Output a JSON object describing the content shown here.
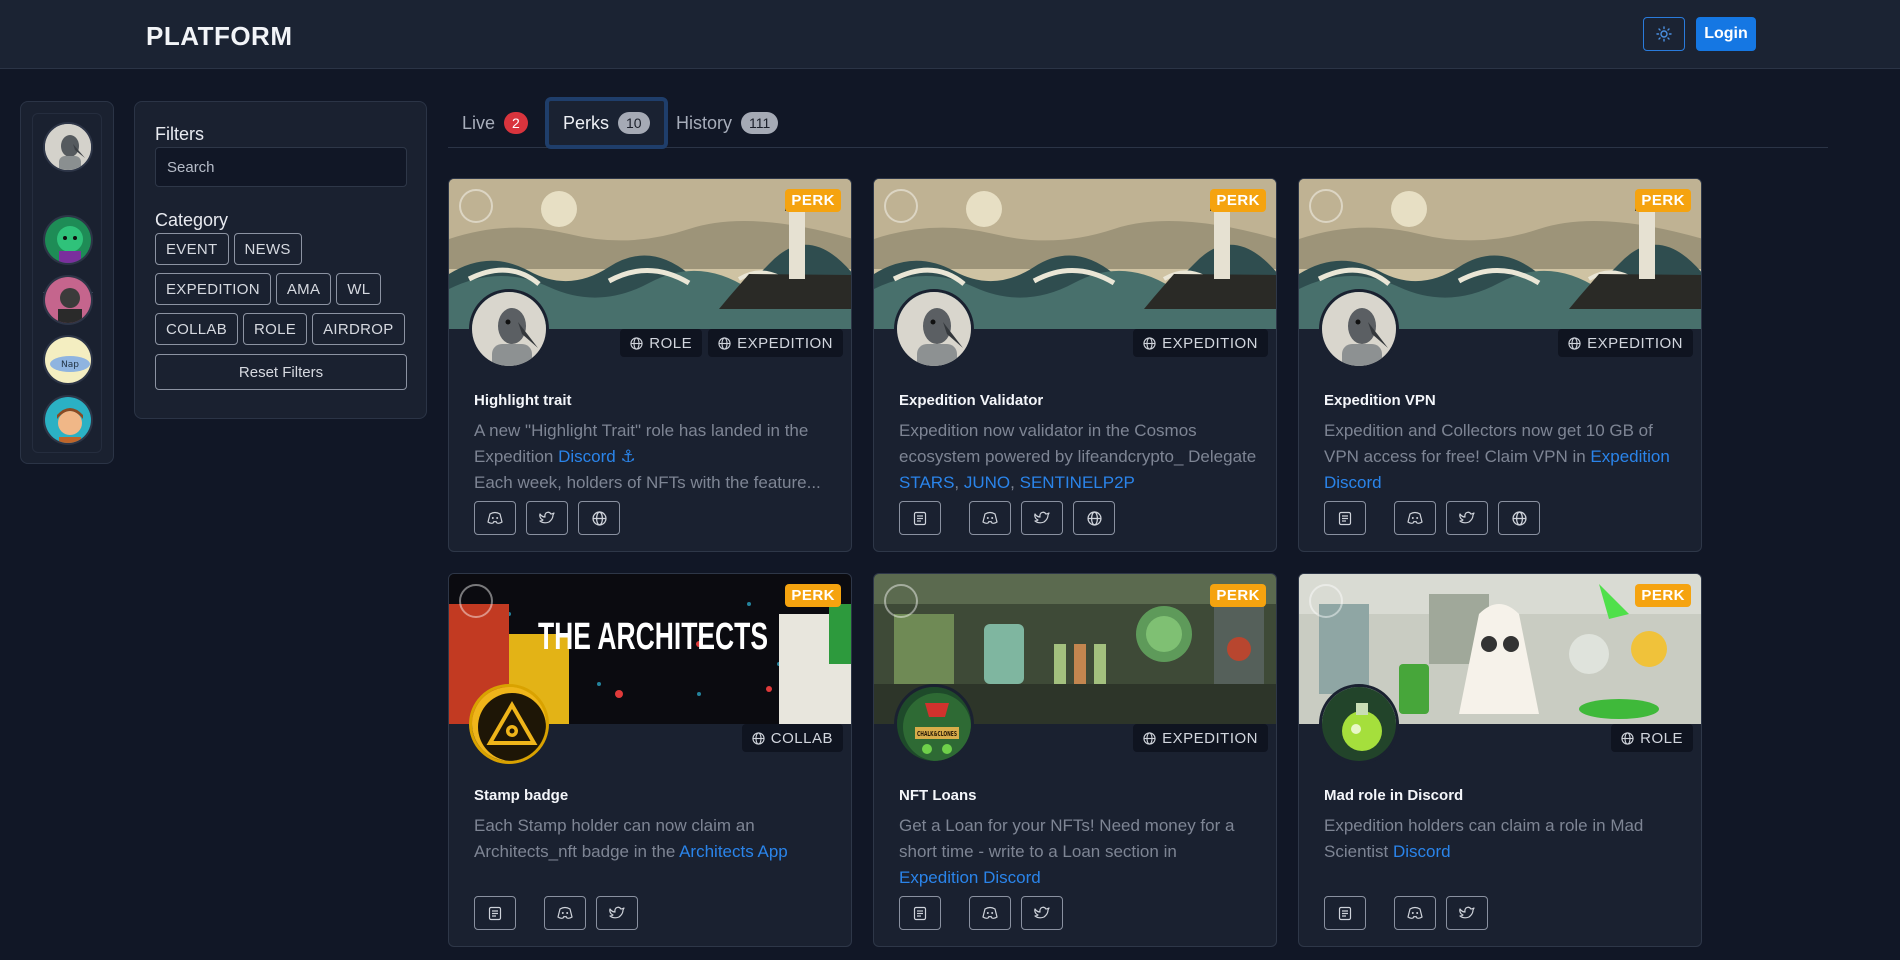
{
  "header": {
    "brand": "PLATFORM",
    "login_label": "Login"
  },
  "rail": {
    "avatars": [
      "bird-avatar",
      "alien-avatar",
      "character-avatar",
      "nap-time-avatar",
      "boy-avatar"
    ]
  },
  "filters": {
    "title": "Filters",
    "search_placeholder": "Search",
    "category_title": "Category",
    "categories": [
      "EVENT",
      "NEWS",
      "EXPEDITION",
      "AMA",
      "WL",
      "COLLAB",
      "ROLE",
      "AIRDROP"
    ],
    "reset_label": "Reset Filters"
  },
  "tabs": [
    {
      "label": "Live",
      "count": "2"
    },
    {
      "label": "Perks",
      "count": "10"
    },
    {
      "label": "History",
      "count": "111"
    }
  ],
  "cards": [
    {
      "badge": "PERK",
      "tags": [
        "ROLE",
        "EXPEDITION"
      ],
      "title": "Highlight trait",
      "desc_1": "A new \"Highlight Trait\" role has landed in the Expedition ",
      "link_1": "Discord ⚓",
      "desc_2": " Each week, holders of NFTs with the feature...",
      "icons": [
        "discord-icon",
        "twitter-icon",
        "globe-icon"
      ]
    },
    {
      "badge": "PERK",
      "tags": [
        "EXPEDITION"
      ],
      "title": "Expedition Validator",
      "desc_1": "Expedition now validator in the Cosmos ecosystem powered by lifeandcrypto_ Delegate ",
      "link_1": "STARS",
      "sep_1": ", ",
      "link_2": "JUNO",
      "sep_2": ", ",
      "link_3": "SENTINELP2P",
      "icons": [
        "document-icon",
        "discord-icon",
        "twitter-icon",
        "globe-icon"
      ]
    },
    {
      "badge": "PERK",
      "tags": [
        "EXPEDITION"
      ],
      "title": "Expedition VPN",
      "desc_1": "Expedition and Collectors now get 10 GB of VPN access for free! Claim VPN in ",
      "link_1": "Expedition Discord",
      "icons": [
        "document-icon",
        "discord-icon",
        "twitter-icon",
        "globe-icon"
      ]
    },
    {
      "badge": "PERK",
      "tags": [
        "COLLAB"
      ],
      "title": "Stamp badge",
      "banner_text": "THE ARCHITECTS",
      "desc_1": "Each Stamp holder can now claim an Architects_nft badge in the ",
      "link_1": "Architects App",
      "icons": [
        "document-icon",
        "discord-icon",
        "twitter-icon"
      ]
    },
    {
      "badge": "PERK",
      "tags": [
        "EXPEDITION"
      ],
      "title": "NFT Loans",
      "avatar_text": "CHALK&CLONES",
      "desc_1": "Get a Loan for your NFTs! Need money for a short time - write to a Loan section in ",
      "link_1": "Expedition Discord",
      "icons": [
        "document-icon",
        "discord-icon",
        "twitter-icon"
      ]
    },
    {
      "badge": "PERK",
      "tags": [
        "ROLE"
      ],
      "title": "Mad role in Discord",
      "desc_1": "Expedition holders can claim a role in Mad Scientist ",
      "link_1": "Discord",
      "icons": [
        "document-icon",
        "discord-icon",
        "twitter-icon"
      ]
    }
  ],
  "colors": {
    "background": "#111726",
    "panel": "#1a2130",
    "accent": "#1577e3",
    "perk": "#f5a30f",
    "link": "#2a84ea",
    "live_badge": "#d9343d"
  }
}
